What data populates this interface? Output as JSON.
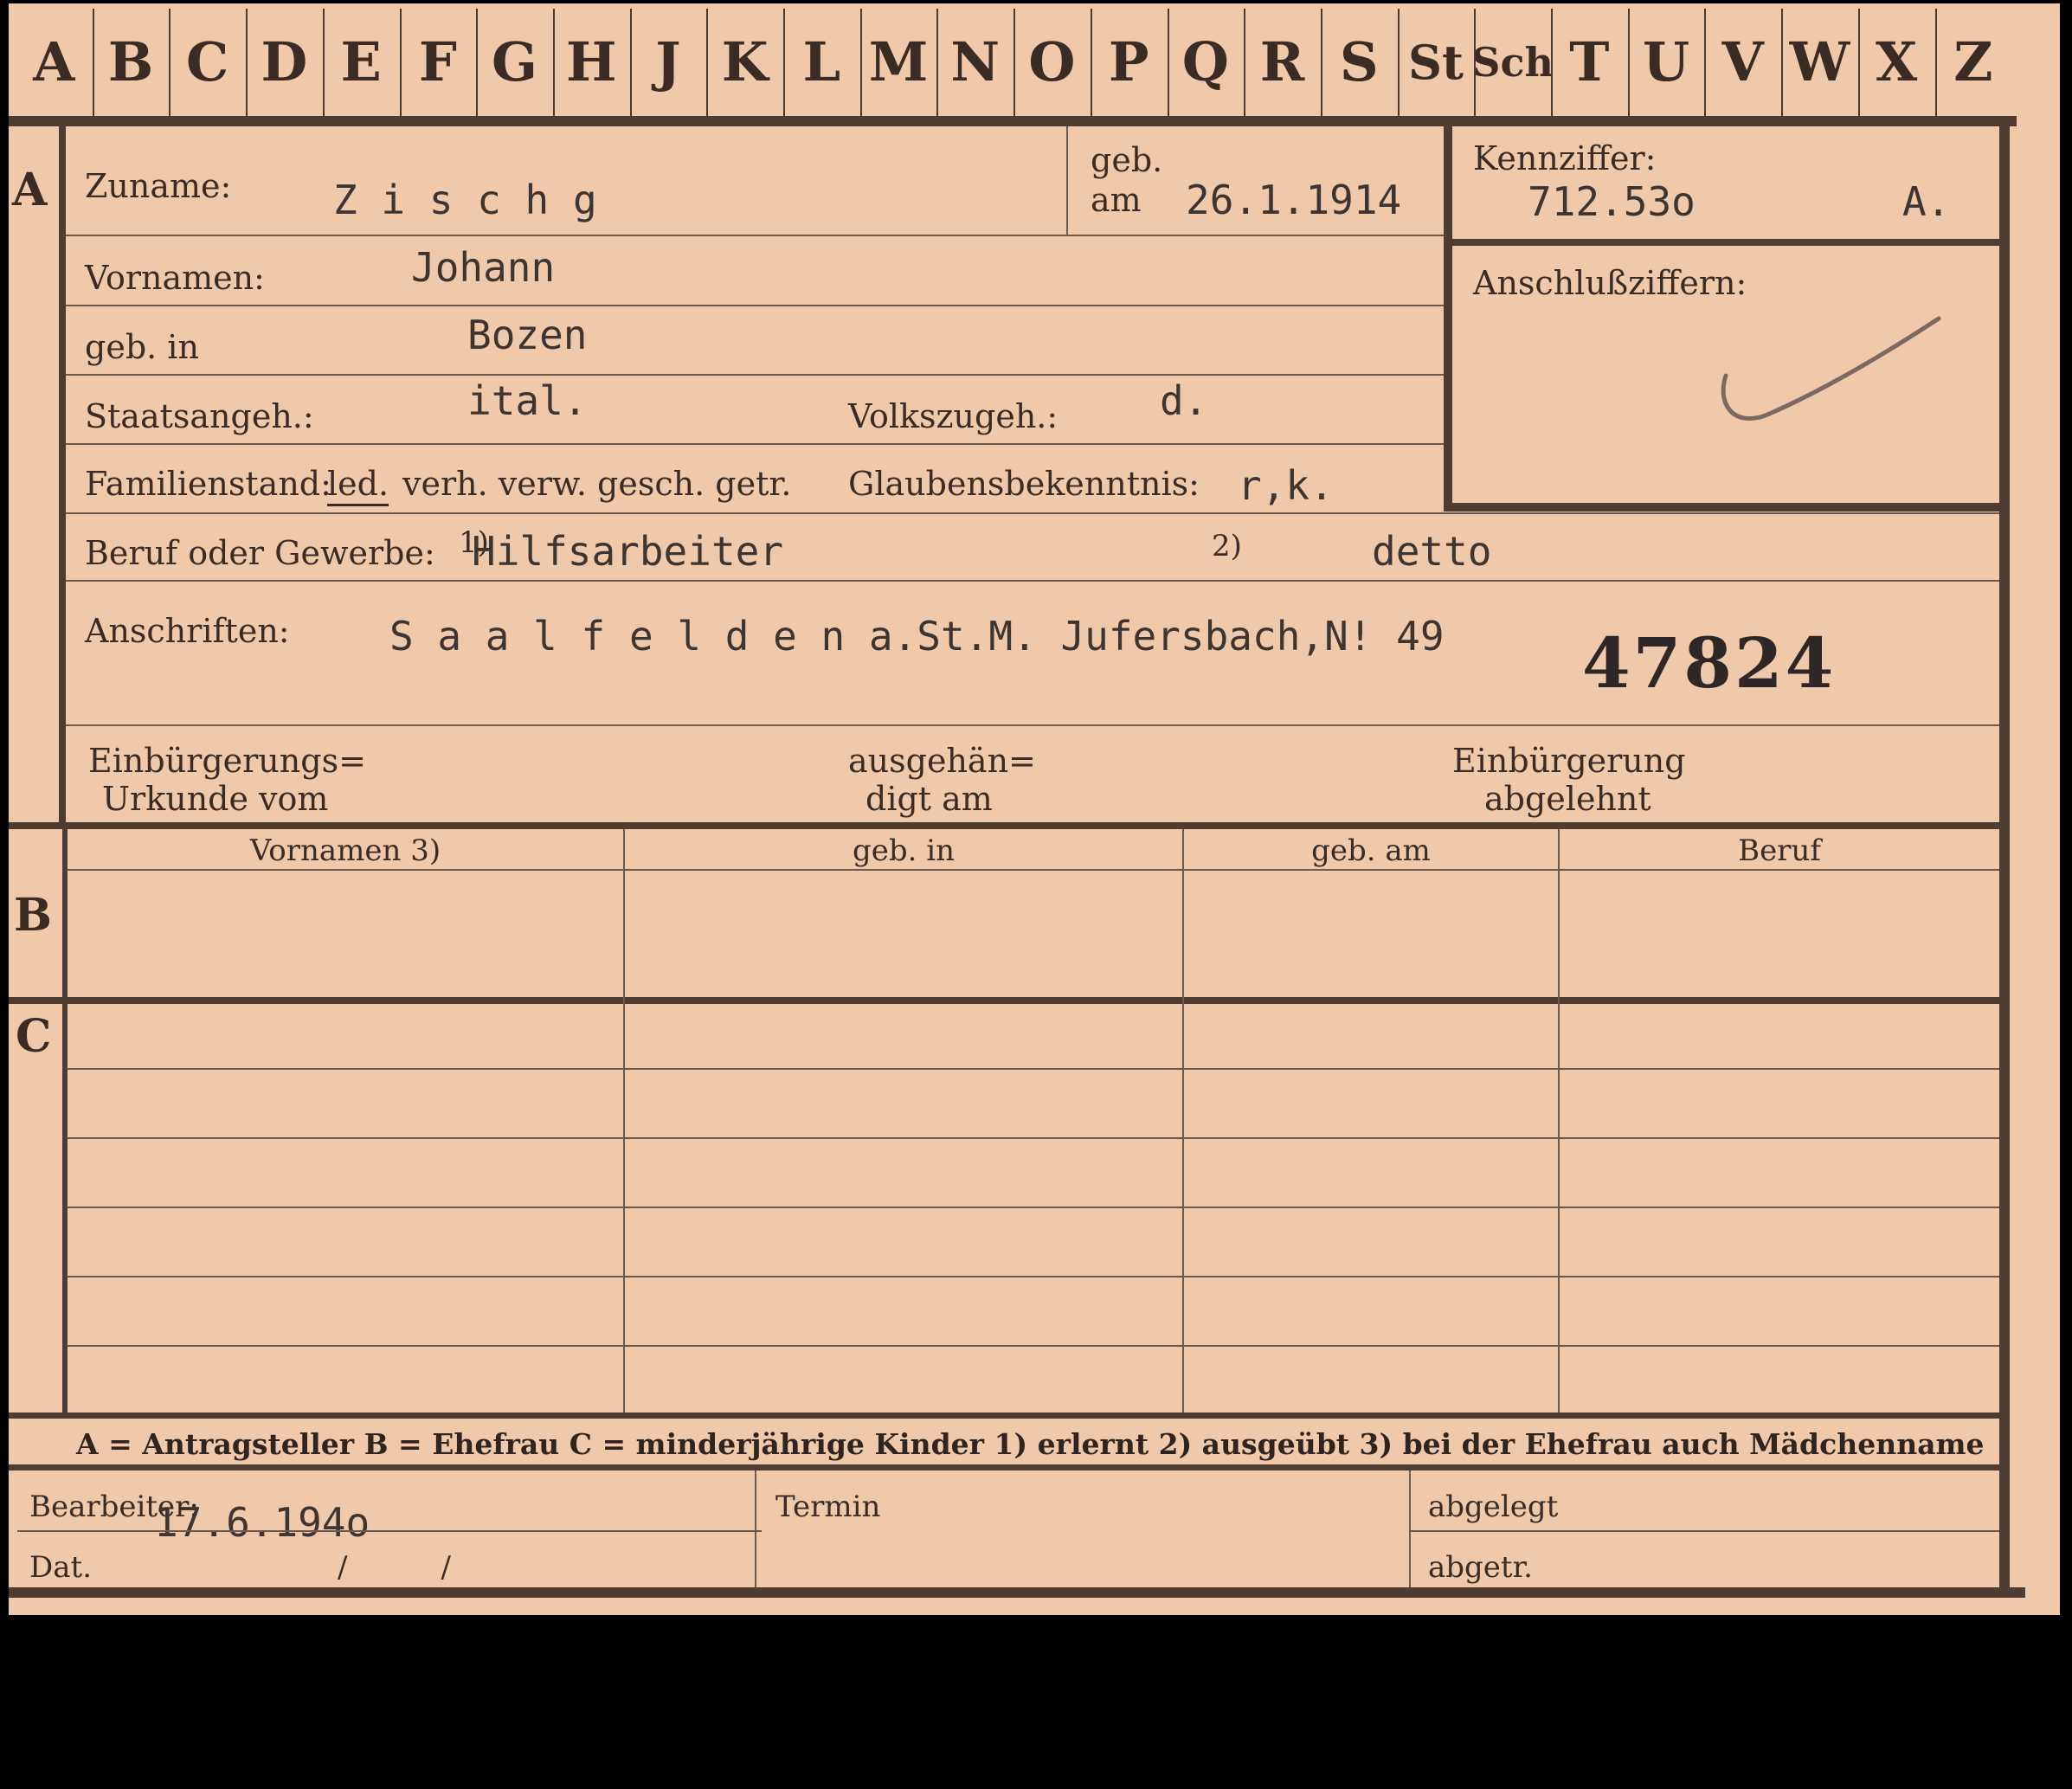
{
  "alphabet": [
    "A",
    "B",
    "C",
    "D",
    "E",
    "F",
    "G",
    "H",
    "J",
    "K",
    "L",
    "M",
    "N",
    "O",
    "P",
    "Q",
    "R",
    "S",
    "St",
    "Sch",
    "T",
    "U",
    "V",
    "W",
    "X",
    "Z"
  ],
  "section_a": {
    "marker": "A",
    "zuname_label": "Zuname:",
    "zuname": "Z i s c h g",
    "geb_label": "geb.",
    "am_label": "am",
    "geb_am": "26.1.1914",
    "kennziffer_label": "Kennziffer:",
    "kennziffer": "712.53o",
    "kennziffer_suffix": "A.",
    "anschluss_label": "Anschlußziffern:",
    "vornamen_label": "Vornamen:",
    "vornamen": "Johann",
    "geb_in_label": "geb. in",
    "geb_in": "Bozen",
    "staatsangeh_label": "Staatsangeh.:",
    "staatsangeh": "ital.",
    "volkszugeh_label": "Volkszugeh.:",
    "volkszugeh": "d.",
    "familienstand_label": "Familienstand:",
    "familienstand_selected": "led.",
    "familienstand_options": "verh. verw. gesch. getr.",
    "glaubens_label": "Glaubensbekenntnis:",
    "glaubens": "r,k.",
    "beruf_label": "Beruf oder Gewerbe:",
    "beruf_note1": "1)",
    "beruf": "Hilfsarbeiter",
    "beruf_note2": "2)",
    "beruf2": "detto",
    "anschriften_label": "Anschriften:",
    "anschrift": "S a a l f e l d e n a.St.M. Jufersbach,N! 49",
    "stamp_number": "47824",
    "einb_urkunde_label_1": "Einbürgerungs=",
    "einb_urkunde_label_2": "Urkunde vom",
    "ausgehaendigt_label_1": "ausgehän=",
    "ausgehaendigt_label_2": "digt am",
    "einb_abgelehnt_label_1": "Einbürgerung",
    "einb_abgelehnt_label_2": "abgelehnt"
  },
  "section_b": {
    "marker": "B",
    "headers": [
      "Vornamen 3)",
      "geb. in",
      "geb. am",
      "Beruf"
    ]
  },
  "section_c": {
    "marker": "C"
  },
  "legend": "A = Antragsteller   B = Ehefrau   C = minderjährige Kinder   1) erlernt   2) ausgeübt   3) bei der Ehefrau auch Mädchenname",
  "footer": {
    "bearbeiter_label": "Bearbeiter:",
    "bearbeiter_date": "17.6.194o",
    "dat_label": "Dat.",
    "dat_value": "/          /",
    "termin_label": "Termin",
    "abgelegt_label": "abgelegt",
    "abgetr_label": "abgetr."
  },
  "colors": {
    "card": "#efc9a9",
    "ink": "#3a2c24",
    "typewriter": "#3d3532",
    "background": "#000000"
  }
}
